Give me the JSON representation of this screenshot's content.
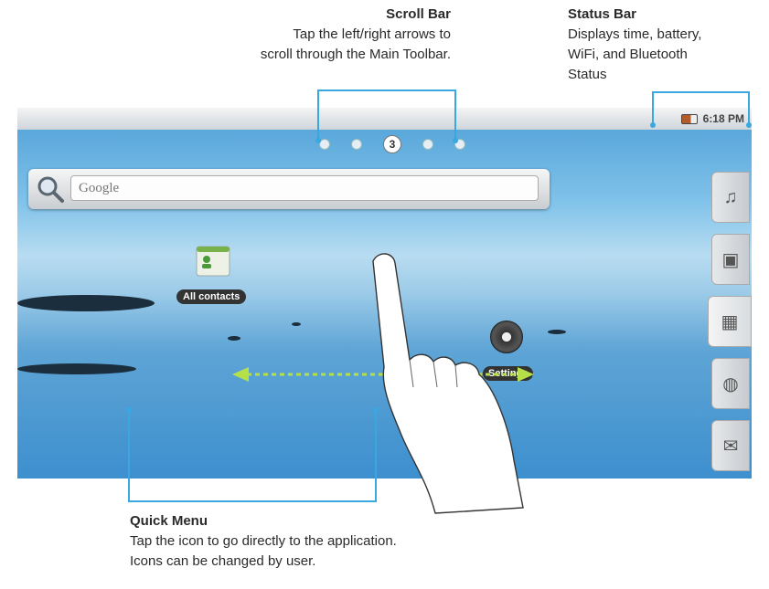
{
  "callouts": {
    "scroll_bar": {
      "title": "Scroll Bar",
      "line1": "Tap the left/right arrows to",
      "line2": "scroll through the Main Toolbar."
    },
    "status_bar": {
      "title": "Status Bar",
      "line1": "Displays time, battery,",
      "line2": "WiFi, and Bluetooth",
      "line3": "Status"
    },
    "quick_menu": {
      "title": "Quick Menu",
      "line1": "Tap the icon to go directly to the application.",
      "line2": "Icons can be changed by user."
    }
  },
  "status": {
    "time": "6:18 PM",
    "battery_icon": "battery-icon"
  },
  "scroll": {
    "current_page": "3",
    "total_dots": 5
  },
  "search": {
    "placeholder": "Google"
  },
  "home": {
    "contacts_label": "All contacts",
    "settings_label": "Settings"
  },
  "dock": {
    "items": [
      "music-icon",
      "gallery-icon",
      "app-drawer-icon",
      "browser-icon",
      "email-icon"
    ],
    "active_index": 2
  },
  "colors": {
    "callout_line": "#3aa8e0"
  }
}
